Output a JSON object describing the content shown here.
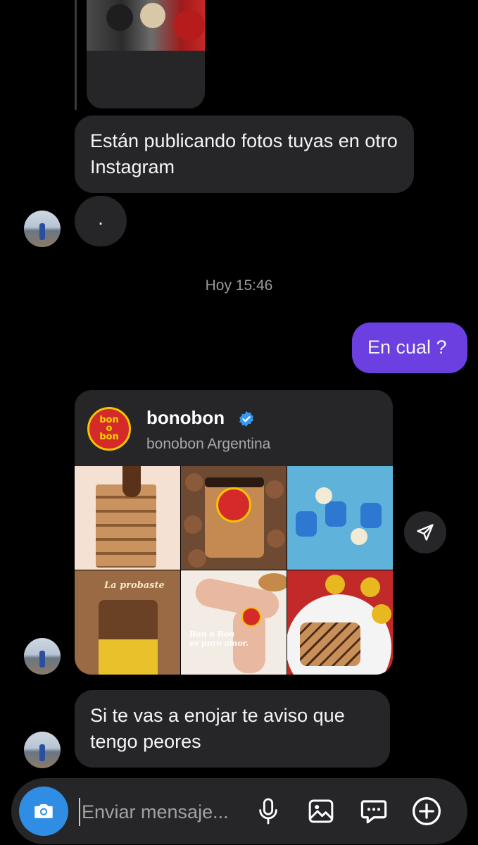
{
  "messages": {
    "msg1": "Están publicando fotos tuyas en otro Instagram",
    "msg2": ".",
    "timestamp": "Hoy 15:46",
    "sent1": "En cual ?",
    "msg3": "Si te vas a enojar te aviso que tengo peores"
  },
  "shared_post": {
    "account_name": "bonobon",
    "subtitle": "bonobon Argentina",
    "verified": true,
    "logo_text": [
      "bon",
      "o",
      "bon"
    ],
    "tile1_text": "",
    "tile4_text": "La probaste",
    "tile5_text_line1": "Bon o Bon",
    "tile5_text_line2": "es puro amor."
  },
  "composer": {
    "placeholder": "Enviar mensaje..."
  },
  "colors": {
    "background": "#000000",
    "received_bubble": "#262628",
    "sent_bubble": "#6b3fe0",
    "camera_button": "#2f8de4",
    "verified_badge": "#3897f0"
  },
  "icons": [
    "camera-icon",
    "microphone-icon",
    "gallery-icon",
    "sticker-chat-icon",
    "add-circle-icon",
    "send-share-icon",
    "verified-badge-icon"
  ]
}
